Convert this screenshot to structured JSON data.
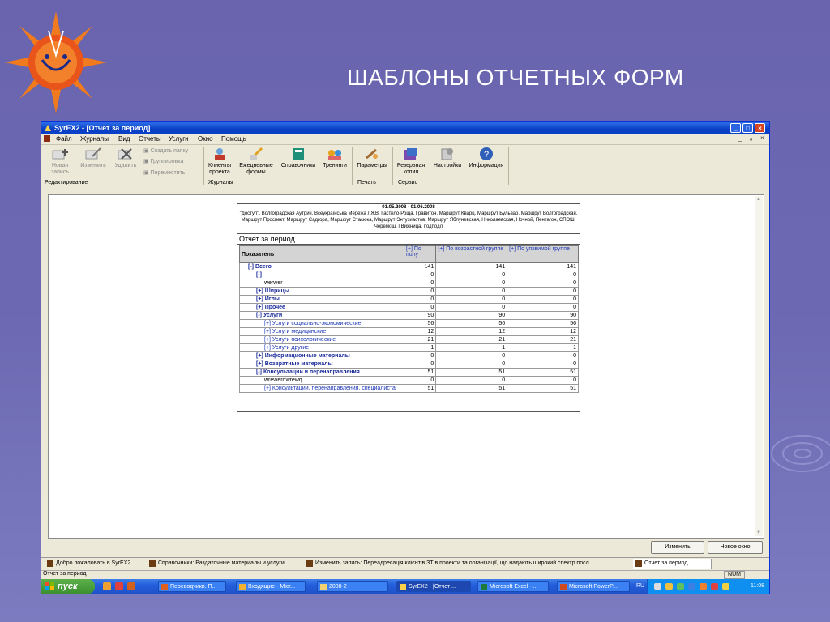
{
  "slide_title": "ШАБЛОНЫ ОТЧЕТНЫХ ФОРМ",
  "window": {
    "title": "SyrEX2 - [Отчет за период]",
    "controls": [
      "_",
      "□",
      "×"
    ],
    "mdi_controls": [
      "_",
      "ₐ",
      "×"
    ]
  },
  "menu": [
    "Файл",
    "Журналы",
    "Вид",
    "Отчеты",
    "Услуги",
    "Окно",
    "Помощь"
  ],
  "toolbar": {
    "editing": {
      "new": "Новая запись",
      "edit": "Изменить",
      "delete": "Удалить",
      "create_folder": "Создать папку",
      "group": "Группировка",
      "move": "Переместить",
      "group_label": "Редактирование"
    },
    "journals": {
      "clients": "Клиенты проекта",
      "daily": "Ежедневные формы",
      "refs": "Справочники",
      "trainings": "Тренинги",
      "group_label": "Журналы"
    },
    "print": {
      "params": "Параметры",
      "group_label": "Печать"
    },
    "service": {
      "backup": "Резервная копия",
      "settings": "Настройки",
      "info": "Информация",
      "group_label": "Сервис"
    }
  },
  "report": {
    "date_range": "01.05.2008 - 01.06.2008",
    "description": "\"Доступ\", Волгоградская Аутрич, Всеукраїнська Мережа ЛЖВ, Гастело-Роща, Гравитон, Маршрут Кварц, Маршрут Бульвар, Маршрут Волгоградская, Маршрут Проспект, Маршрут Садгора, Маршрут Стасюка, Маршрут Энтузиастов, Маршрут Яблуневская, Николаевская, Ночной, Пентагон, СПОШ, Черемош, г.Вижница, подподл",
    "heading": "Отчет за период",
    "columns": [
      "Показатель",
      "[+] По полу",
      "[+] По возрастной группе",
      "[+] По уязвимой группе"
    ],
    "rows": [
      {
        "label": "[-] Всего",
        "level": 1,
        "style": "b",
        "values": [
          "141",
          "141",
          "141"
        ]
      },
      {
        "label": "[-]",
        "level": 2,
        "style": "b",
        "values": [
          "0",
          "0",
          "0"
        ]
      },
      {
        "label": "werwer",
        "level": 3,
        "style": "",
        "values": [
          "0",
          "0",
          "0"
        ]
      },
      {
        "label": "[+] Шприцы",
        "level": 2,
        "style": "b",
        "values": [
          "0",
          "0",
          "0"
        ]
      },
      {
        "label": "[+] Иглы",
        "level": 2,
        "style": "b",
        "values": [
          "0",
          "0",
          "0"
        ]
      },
      {
        "label": "[+] Прочее",
        "level": 2,
        "style": "b",
        "values": [
          "0",
          "0",
          "0"
        ]
      },
      {
        "label": "[-] Услуги",
        "level": 2,
        "style": "b",
        "values": [
          "90",
          "90",
          "90"
        ]
      },
      {
        "label": "[+] Услуги социально-экономические",
        "level": 3,
        "style": "l",
        "values": [
          "56",
          "56",
          "56"
        ]
      },
      {
        "label": "[+] Услуги медицинские",
        "level": 3,
        "style": "l",
        "values": [
          "12",
          "12",
          "12"
        ]
      },
      {
        "label": "[+] Услуги психологические",
        "level": 3,
        "style": "l",
        "values": [
          "21",
          "21",
          "21"
        ]
      },
      {
        "label": "[+] Услуги другие",
        "level": 3,
        "style": "l",
        "values": [
          "1",
          "1",
          "1"
        ]
      },
      {
        "label": "[+] Информационные материалы",
        "level": 2,
        "style": "b",
        "values": [
          "0",
          "0",
          "0"
        ]
      },
      {
        "label": "[+] Возвратные материалы",
        "level": 2,
        "style": "b",
        "values": [
          "0",
          "0",
          "0"
        ]
      },
      {
        "label": "[-] Консультации и перенаправления",
        "level": 2,
        "style": "b",
        "values": [
          "51",
          "51",
          "51"
        ]
      },
      {
        "label": "wrewerqwrewq",
        "level": 3,
        "style": "",
        "values": [
          "0",
          "0",
          "0"
        ]
      },
      {
        "label": "[+] Консультации, перенаправления, специалиста",
        "level": 3,
        "style": "l",
        "values": [
          "51",
          "51",
          "51"
        ]
      }
    ]
  },
  "buttons": {
    "edit": "Изменить",
    "new_window": "Новое окно"
  },
  "tabs": [
    "Добро пожаловать в SyrEX2",
    "Справочники: Раздаточные материалы и услуги",
    "Изменить запись: Переадресація клієнтів ЗТ в проекти та організації, що надають широкий спектр посл...",
    "Отчет за период"
  ],
  "status": {
    "text": "Отчет за период",
    "num": "NUM"
  },
  "taskbar": {
    "start": "пуск",
    "items": [
      "Переводчики. П...",
      "Входящие - Micr...",
      "2008-2",
      "SyrEX2 - [Отчет ...",
      "Microsoft Excel - ...",
      "Microsoft PowerP..."
    ],
    "lang": "RU",
    "clock": "11:08"
  },
  "colors": {
    "accent": "#0a3fc4",
    "taskbar": "#245edb",
    "start": "#3c8f2f",
    "slide_bg": "#6a64ae"
  }
}
